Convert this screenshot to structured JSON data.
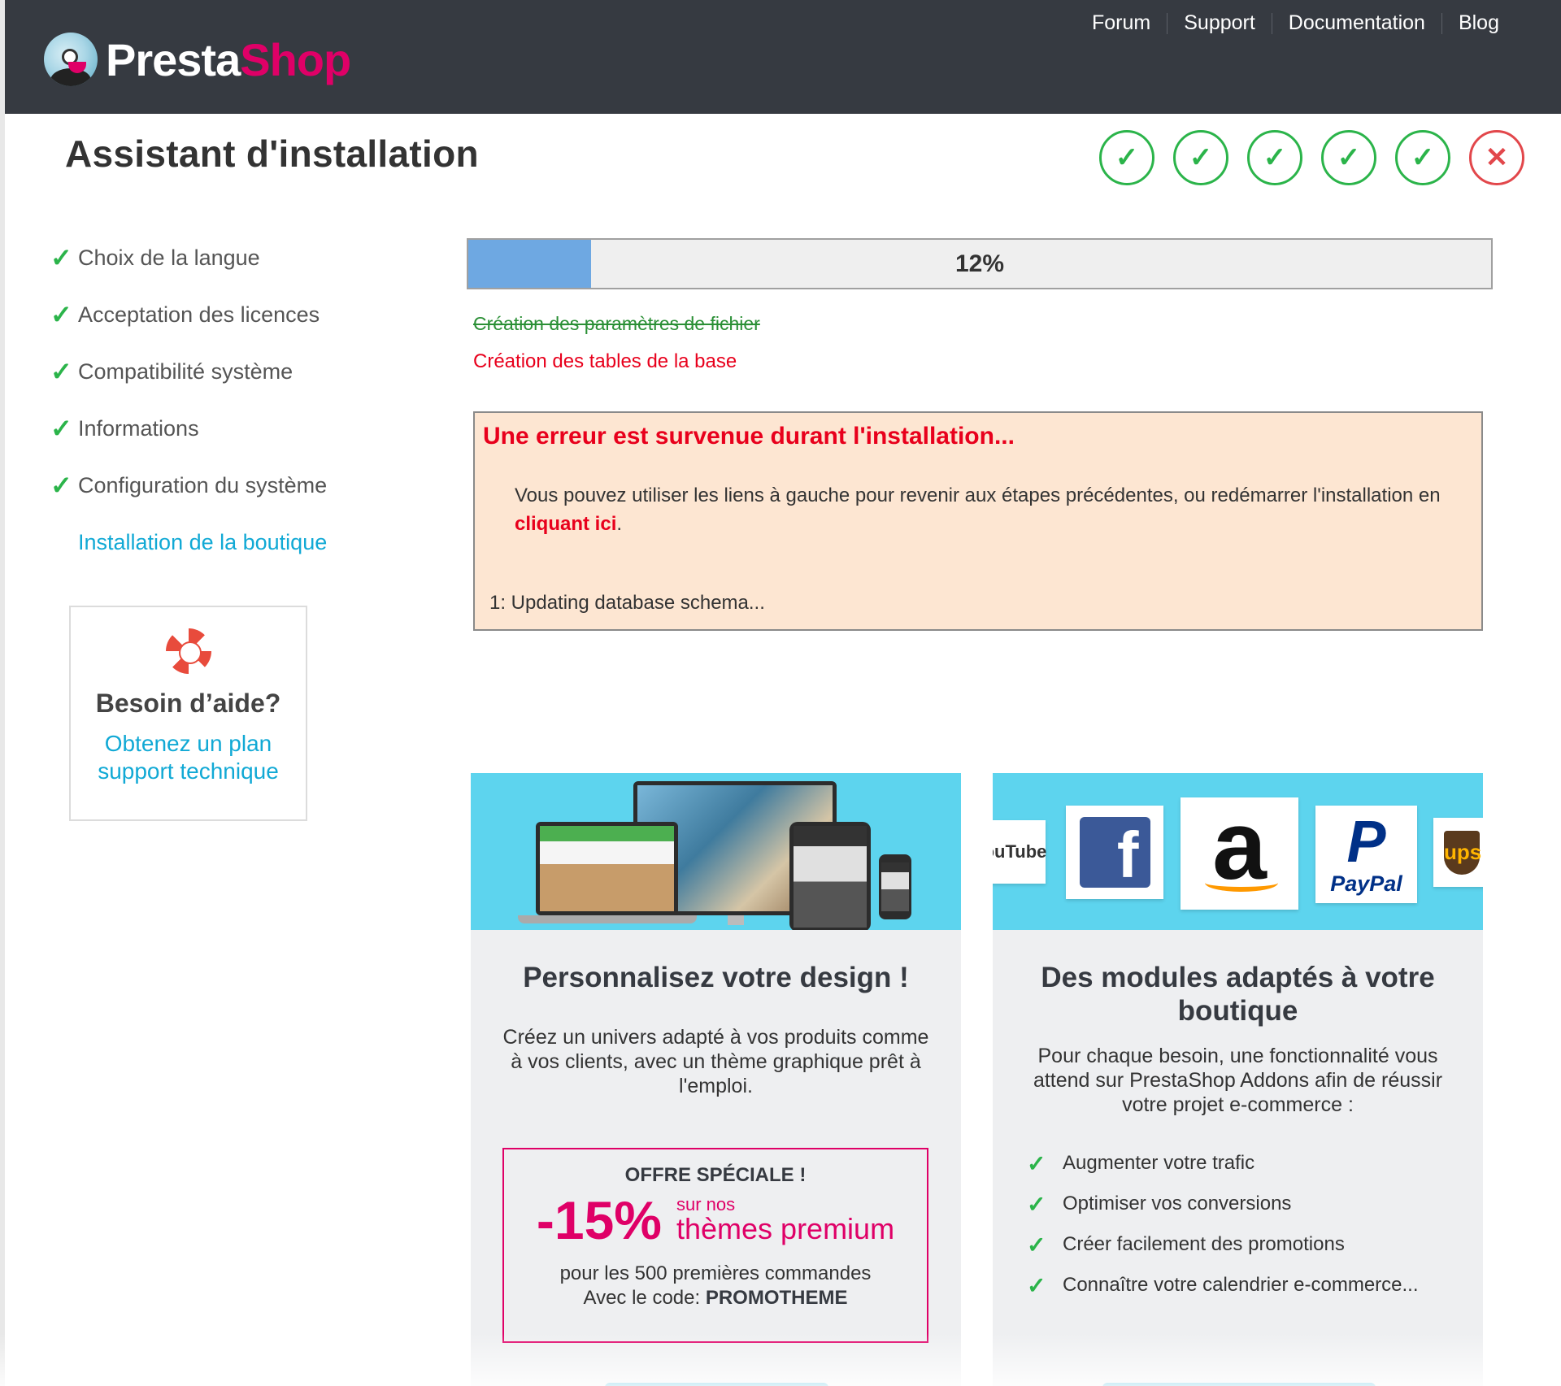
{
  "header": {
    "logo_part1": "Presta",
    "logo_part2": "Shop",
    "nav": [
      "Forum",
      "Support",
      "Documentation",
      "Blog"
    ]
  },
  "title": "Assistant d'installation",
  "steps_indicator": [
    {
      "status": "done",
      "icon": "check-icon"
    },
    {
      "status": "done",
      "icon": "check-icon"
    },
    {
      "status": "done",
      "icon": "check-icon"
    },
    {
      "status": "done",
      "icon": "check-icon"
    },
    {
      "status": "done",
      "icon": "check-icon"
    },
    {
      "status": "error",
      "icon": "x-icon"
    }
  ],
  "sidebar": {
    "items": [
      {
        "label": "Choix de la langue",
        "done": true
      },
      {
        "label": "Acceptation des licences",
        "done": true
      },
      {
        "label": "Compatibilité système",
        "done": true
      },
      {
        "label": "Informations",
        "done": true
      },
      {
        "label": "Configuration du système",
        "done": true
      },
      {
        "label": "Installation de la boutique",
        "done": false,
        "active": true
      }
    ],
    "help": {
      "title": "Besoin d’aide?",
      "link_line1": "Obtenez un plan",
      "link_line2": "support technique"
    }
  },
  "progress": {
    "value": 0.12,
    "label": "12%",
    "completed_step": "Création des paramètres de fichier",
    "failed_step": "Création des tables de la base"
  },
  "error": {
    "title": "Une erreur est survenue durant l'installation...",
    "message_before": "Vous pouvez utiliser les liens à gauche pour revenir aux étapes précédentes, ou redémarrer l'installation en ",
    "link": "cliquant ici",
    "message_after": ".",
    "detail": "1: Updating database schema..."
  },
  "promo_design": {
    "title": "Personnalisez votre design !",
    "text": "Créez un univers adapté à vos produits comme à vos clients, avec un thème graphique prêt à l'emploi.",
    "offer": {
      "heading": "OFFRE SPÉCIALE !",
      "percent": "-15%",
      "small": "sur nos",
      "large": "thèmes premium",
      "line1": "pour les 500 premières commandes",
      "code_label": "Avec le code: ",
      "code": "PROMOTHEME"
    }
  },
  "promo_modules": {
    "title": "Des modules adaptés à votre boutique",
    "text": "Pour chaque besoin, une fonctionnalité vous attend sur PrestaShop Addons afin de réussir votre projet e-commerce :",
    "features": [
      "Augmenter votre trafic",
      "Optimiser vos conversions",
      "Créer facilement des promotions",
      "Connaître votre calendrier e-commerce..."
    ],
    "brands": [
      "ouTube",
      "f",
      "a",
      "P",
      "PayPal",
      "ups"
    ]
  },
  "colors": {
    "header_bg": "#363a41",
    "brand_pink": "#df0067",
    "success": "#2bb44a",
    "error": "#e8001c",
    "link": "#11a9d5",
    "progress_fill": "#6ea8e2"
  }
}
